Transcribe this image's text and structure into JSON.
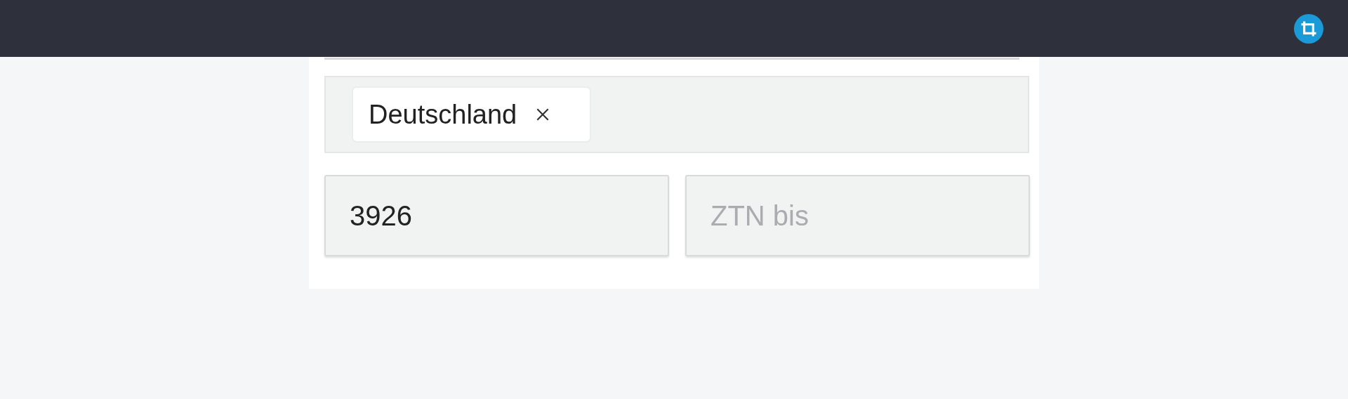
{
  "country_filter": {
    "chips": [
      {
        "label": "Deutschland"
      }
    ]
  },
  "range": {
    "from": {
      "value": "3926"
    },
    "to": {
      "placeholder": "ZTN bis"
    }
  }
}
